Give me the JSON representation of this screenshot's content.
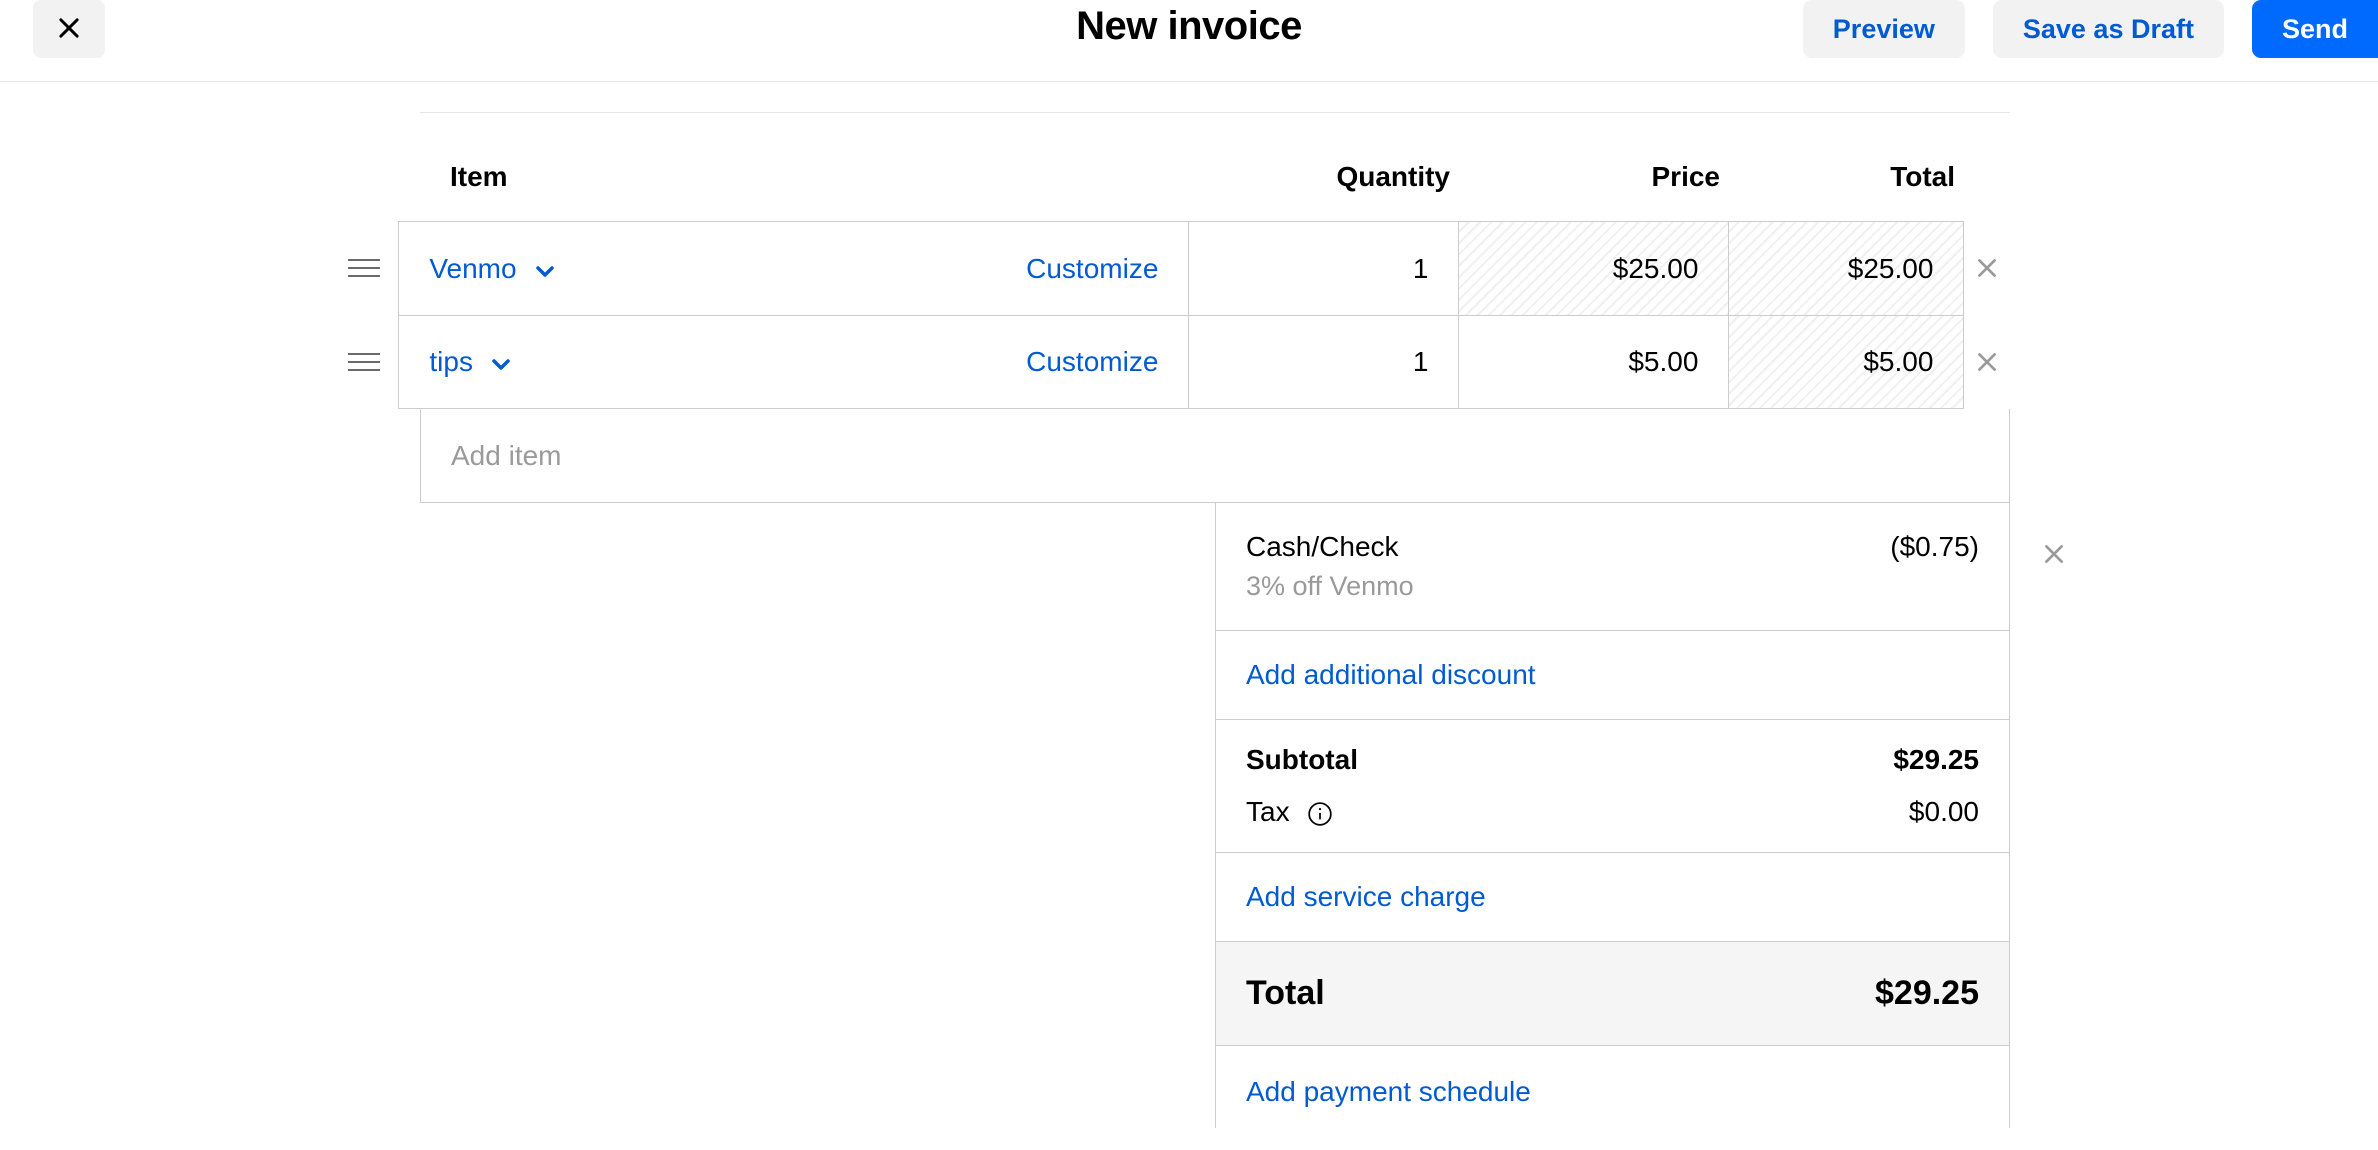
{
  "header": {
    "title": "New invoice",
    "preview_label": "Preview",
    "draft_label": "Save as Draft",
    "send_label": "Send"
  },
  "columns": {
    "item": "Item",
    "quantity": "Quantity",
    "price": "Price",
    "total": "Total"
  },
  "lines": [
    {
      "name": "Venmo",
      "customize": "Customize",
      "qty": "1",
      "price": "$25.00",
      "total": "$25.00",
      "price_hatched": true
    },
    {
      "name": "tips",
      "customize": "Customize",
      "qty": "1",
      "price": "$5.00",
      "total": "$5.00",
      "price_hatched": false
    }
  ],
  "add_item_placeholder": "Add item",
  "discount": {
    "label": "Cash/Check",
    "sublabel": "3% off Venmo",
    "amount": "($0.75)"
  },
  "links": {
    "add_discount": "Add additional discount",
    "add_service_charge": "Add service charge",
    "add_payment_schedule": "Add payment schedule"
  },
  "summary": {
    "subtotal_label": "Subtotal",
    "subtotal_value": "$29.25",
    "tax_label": "Tax",
    "tax_value": "$0.00",
    "total_label": "Total",
    "total_value": "$29.25"
  }
}
